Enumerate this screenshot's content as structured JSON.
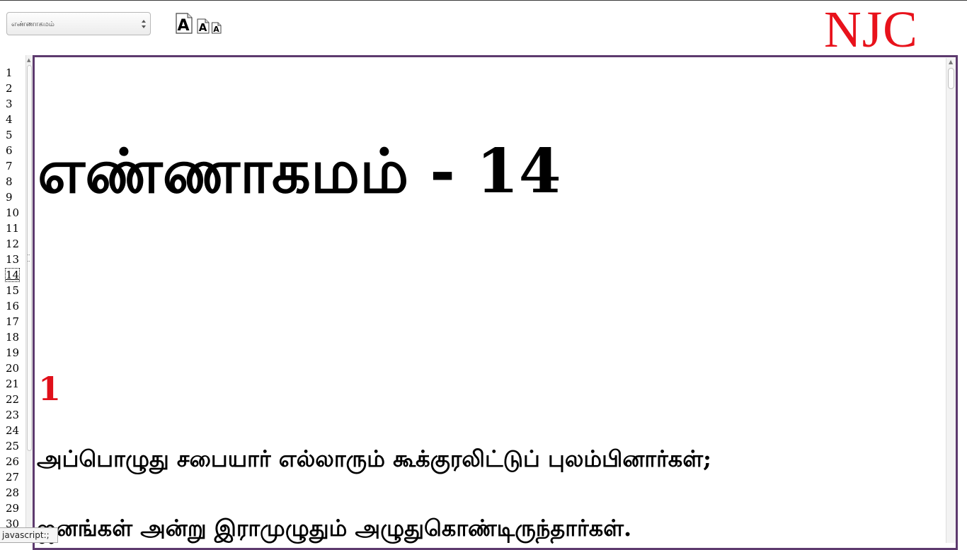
{
  "toolbar": {
    "book_select_value": "எண்ணாகமம்",
    "font_buttons": [
      {
        "name": "font-large-button",
        "glyph": "A"
      },
      {
        "name": "font-medium-button",
        "glyph": "A"
      },
      {
        "name": "font-small-button",
        "glyph": "A"
      }
    ]
  },
  "logo": {
    "text": "NJC",
    "color": "#e8121b"
  },
  "chapters": {
    "items": [
      "1",
      "2",
      "3",
      "4",
      "5",
      "6",
      "7",
      "8",
      "9",
      "10",
      "11",
      "12",
      "13",
      "14",
      "15",
      "16",
      "17",
      "18",
      "19",
      "20",
      "21",
      "22",
      "23",
      "24",
      "25",
      "26",
      "27",
      "28",
      "29",
      "30"
    ],
    "current": "14"
  },
  "content": {
    "title": "எண்ணாகமம் - 14",
    "verse_number": "1",
    "verse_lines": [
      "அப்பொழுது சபையார் எல்லாரும் கூக்குரலிட்டுப் புலம்பினார்கள்;",
      "ஜனங்கள் அன்று இராமுழுதும் அழுதுகொண்டிருந்தார்கள்."
    ]
  },
  "status_bar": {
    "text": "javascript:;"
  },
  "colors": {
    "frame_border": "#5d3a6e",
    "verse_number": "#e0101a"
  }
}
